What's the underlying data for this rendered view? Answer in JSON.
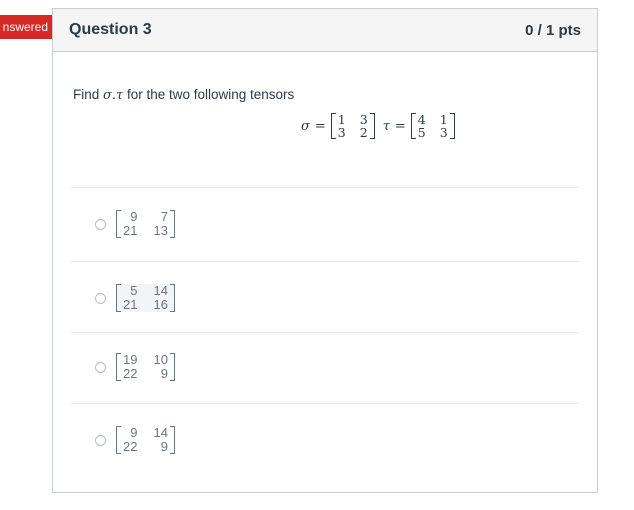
{
  "badge": {
    "label": "nswered"
  },
  "question": {
    "title": "Question 3",
    "points": "0 / 1 pts",
    "prompt_prefix": "Find ",
    "prompt_symbol": "σ.τ",
    "prompt_suffix": " for the two following tensors",
    "sigma": {
      "symbol": "σ",
      "eq": "=",
      "matrix": [
        [
          "1",
          "3"
        ],
        [
          "3",
          "2"
        ]
      ]
    },
    "tau": {
      "symbol": "τ",
      "eq": "=",
      "matrix": [
        [
          "4",
          "1"
        ],
        [
          "5",
          "3"
        ]
      ]
    }
  },
  "answers": [
    {
      "matrix": [
        [
          "9",
          "7"
        ],
        [
          "21",
          "13"
        ]
      ]
    },
    {
      "matrix": [
        [
          "5",
          "14"
        ],
        [
          "21",
          "16"
        ]
      ]
    },
    {
      "matrix": [
        [
          "19",
          "10"
        ],
        [
          "22",
          "9"
        ]
      ]
    },
    {
      "matrix": [
        [
          "9",
          "14"
        ],
        [
          "22",
          "9"
        ]
      ]
    }
  ]
}
